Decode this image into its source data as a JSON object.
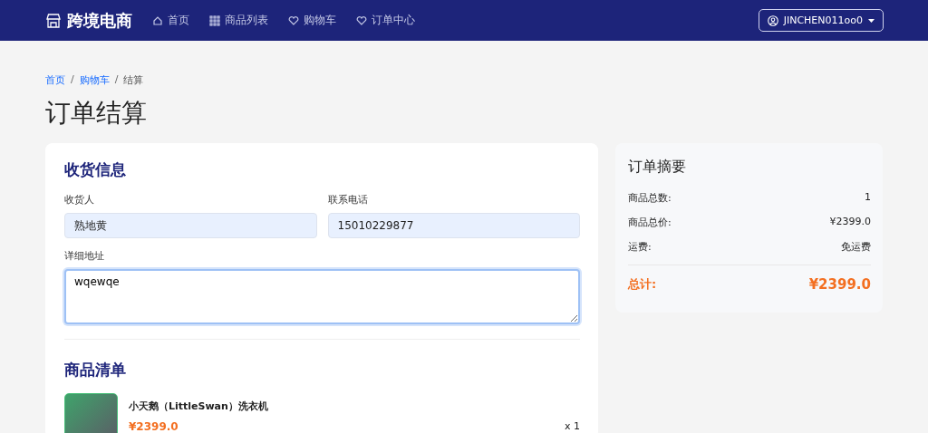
{
  "navbar": {
    "brand": "跨境电商",
    "links": [
      {
        "label": "首页",
        "kind": "home",
        "selected": false
      },
      {
        "label": "商品列表",
        "kind": "grid",
        "selected": false
      },
      {
        "label": "购物车",
        "kind": "heart",
        "selected": false
      },
      {
        "label": "订单中心",
        "kind": "heart",
        "selected": false
      }
    ],
    "user": "JINCHEN011oo0"
  },
  "breadcrumb": [
    {
      "text": "首页",
      "kind": "link"
    },
    {
      "text": "/",
      "kind": "separator"
    },
    {
      "text": "购物车",
      "kind": "link"
    },
    {
      "text": "/",
      "kind": "separator"
    },
    {
      "text": "结算",
      "kind": "current"
    }
  ],
  "title": "订单结算",
  "shipping": {
    "heading": "收货信息",
    "fields": [
      {
        "label": "收货人",
        "value": "熟地黄",
        "kind": "input"
      },
      {
        "label": "联系电话",
        "value": "15010229877",
        "kind": "input"
      },
      {
        "label": "详细地址",
        "value": "wqewqe",
        "kind": "textarea"
      }
    ]
  },
  "items": {
    "heading": "商品清单",
    "products": [
      {
        "name": "小天鹅（LittleSwan）洗衣机",
        "price": "¥2399.0",
        "quantity": "x 1"
      }
    ]
  },
  "summary": {
    "heading": "订单摘要",
    "rows": [
      {
        "label": "商品总数:",
        "value": "1"
      },
      {
        "label": "商品总价:",
        "value": "¥2399.0"
      },
      {
        "label": "运费:",
        "value": "免运费"
      }
    ],
    "total_label": "总计:",
    "total_value": "¥2399.0"
  }
}
